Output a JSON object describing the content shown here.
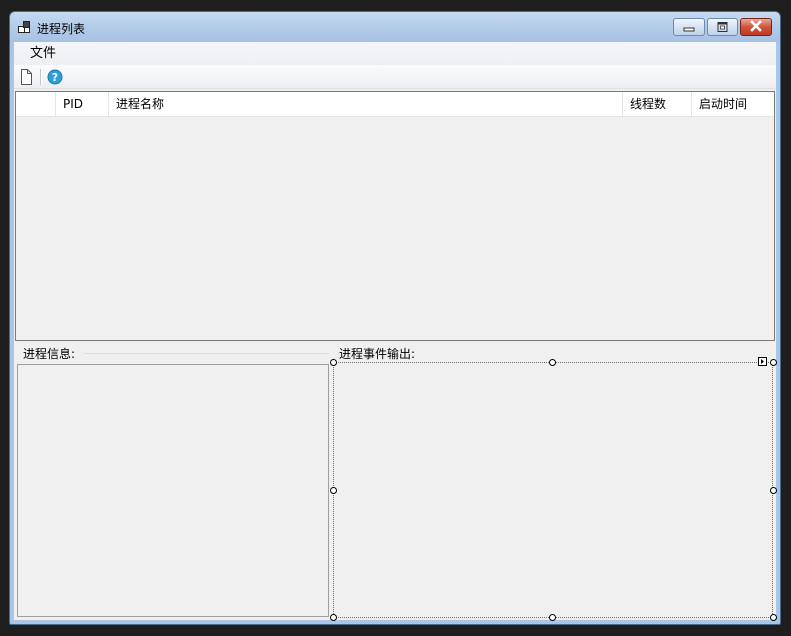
{
  "window": {
    "title": "进程列表",
    "app_icon": "window-app-icon"
  },
  "title_buttons": {
    "minimize_icon": "minimize-icon",
    "maximize_icon": "maximize-icon",
    "close_icon": "close-icon"
  },
  "menu": {
    "items": [
      "文件"
    ]
  },
  "toolbar": {
    "new_icon": "new-document-icon",
    "help_icon": "help-icon",
    "help_color": "#2aa0da"
  },
  "process_list": {
    "columns": [
      "",
      "PID",
      "进程名称",
      "线程数",
      "启动时间"
    ],
    "rows": []
  },
  "process_info": {
    "label": "进程信息:"
  },
  "event_output": {
    "label": "进程事件输出:"
  }
}
